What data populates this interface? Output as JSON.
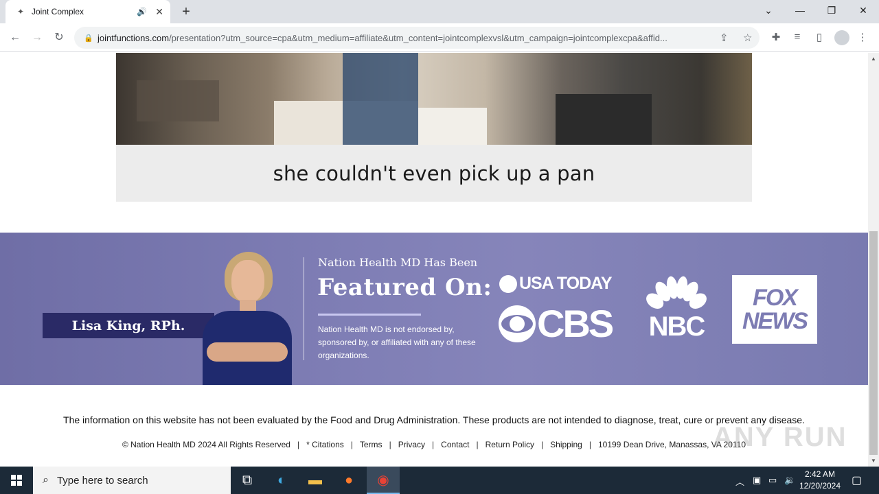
{
  "browser": {
    "tab_title": "Joint Complex",
    "url_domain": "jointfunctions.com",
    "url_path": "/presentation?utm_source=cpa&utm_medium=affiliate&utm_content=jointcomplexvsl&utm_campaign=jointcomplexcpa&affid...",
    "new_tab_label": "+"
  },
  "video": {
    "caption": "she couldn't even pick up a pan"
  },
  "feature": {
    "person_name": "Lisa King, RPh.",
    "pre_heading": "Nation Health MD Has Been",
    "heading": "Featured On:",
    "note": "Nation Health MD is not endorsed by, sponsored by, or affiliated with any of these organizations.",
    "logos": {
      "usa_today": "USA TODAY",
      "cbs": "CBS",
      "nbc": "NBC",
      "fox_line1": "FOX",
      "fox_line2": "NEWS"
    }
  },
  "footer": {
    "disclaimer": "The information on this website has not been evaluated by the Food and Drug Administration. These products are not intended to diagnose, treat, cure or prevent any disease.",
    "copyright": "© Nation Health MD 2024 All Rights Reserved",
    "links": [
      "* Citations",
      "Terms",
      "Privacy",
      "Contact",
      "Return Policy",
      "Shipping"
    ],
    "address": "10199 Dean Drive, Manassas, VA 20110"
  },
  "watermark": "ANY RUN",
  "taskbar": {
    "search_placeholder": "Type here to search",
    "time": "2:42 AM",
    "date": "12/20/2024"
  },
  "colors": {
    "feature_bg": "#7f7eb5",
    "name_bar": "#2a2a66",
    "taskbar": "#1c2a38"
  }
}
